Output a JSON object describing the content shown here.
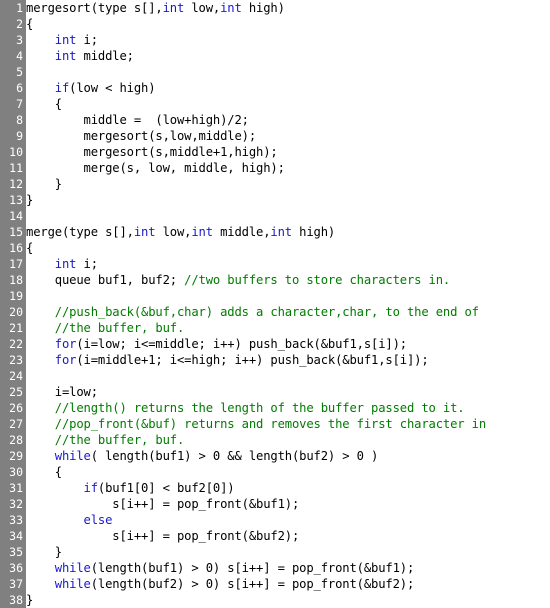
{
  "editor": {
    "language": "c",
    "gutter_bg": "#808080",
    "gutter_fg": "#ffffff",
    "background": "#ffffff",
    "text_color": "#000000",
    "keyword_color": "#1919CC",
    "comment_color": "#007C00",
    "total_lines": 38,
    "line_numbers": [
      "1",
      "2",
      "3",
      "4",
      "5",
      "6",
      "7",
      "8",
      "9",
      "10",
      "11",
      "12",
      "13",
      "14",
      "15",
      "16",
      "17",
      "18",
      "19",
      "20",
      "21",
      "22",
      "23",
      "24",
      "25",
      "26",
      "27",
      "28",
      "29",
      "30",
      "31",
      "32",
      "33",
      "34",
      "35",
      "36",
      "37",
      "38"
    ]
  },
  "code": {
    "lines": [
      {
        "n": "1",
        "tokens": [
          {
            "t": "plain",
            "v": "mergesort(type s[],"
          },
          {
            "t": "kw",
            "v": "int"
          },
          {
            "t": "plain",
            "v": " low,"
          },
          {
            "t": "kw",
            "v": "int"
          },
          {
            "t": "plain",
            "v": " high)"
          }
        ]
      },
      {
        "n": "2",
        "tokens": [
          {
            "t": "plain",
            "v": "{"
          }
        ]
      },
      {
        "n": "3",
        "tokens": [
          {
            "t": "plain",
            "v": "    "
          },
          {
            "t": "kw",
            "v": "int"
          },
          {
            "t": "plain",
            "v": " i;"
          }
        ]
      },
      {
        "n": "4",
        "tokens": [
          {
            "t": "plain",
            "v": "    "
          },
          {
            "t": "kw",
            "v": "int"
          },
          {
            "t": "plain",
            "v": " middle;"
          }
        ]
      },
      {
        "n": "5",
        "tokens": [
          {
            "t": "plain",
            "v": ""
          }
        ]
      },
      {
        "n": "6",
        "tokens": [
          {
            "t": "plain",
            "v": "    "
          },
          {
            "t": "kw",
            "v": "if"
          },
          {
            "t": "plain",
            "v": "(low < high)"
          }
        ]
      },
      {
        "n": "7",
        "tokens": [
          {
            "t": "plain",
            "v": "    {"
          }
        ]
      },
      {
        "n": "8",
        "tokens": [
          {
            "t": "plain",
            "v": "        middle =  (low+high)/2;"
          }
        ]
      },
      {
        "n": "9",
        "tokens": [
          {
            "t": "plain",
            "v": "        mergesort(s,low,middle);"
          }
        ]
      },
      {
        "n": "10",
        "tokens": [
          {
            "t": "plain",
            "v": "        mergesort(s,middle+1,high);"
          }
        ]
      },
      {
        "n": "11",
        "tokens": [
          {
            "t": "plain",
            "v": "        merge(s, low, middle, high);"
          }
        ]
      },
      {
        "n": "12",
        "tokens": [
          {
            "t": "plain",
            "v": "    }"
          }
        ]
      },
      {
        "n": "13",
        "tokens": [
          {
            "t": "plain",
            "v": "}"
          }
        ]
      },
      {
        "n": "14",
        "tokens": [
          {
            "t": "plain",
            "v": ""
          }
        ]
      },
      {
        "n": "15",
        "tokens": [
          {
            "t": "plain",
            "v": "merge(type s[],"
          },
          {
            "t": "kw",
            "v": "int"
          },
          {
            "t": "plain",
            "v": " low,"
          },
          {
            "t": "kw",
            "v": "int"
          },
          {
            "t": "plain",
            "v": " middle,"
          },
          {
            "t": "kw",
            "v": "int"
          },
          {
            "t": "plain",
            "v": " high)"
          }
        ]
      },
      {
        "n": "16",
        "tokens": [
          {
            "t": "plain",
            "v": "{"
          }
        ]
      },
      {
        "n": "17",
        "tokens": [
          {
            "t": "plain",
            "v": "    "
          },
          {
            "t": "kw",
            "v": "int"
          },
          {
            "t": "plain",
            "v": " i;"
          }
        ]
      },
      {
        "n": "18",
        "tokens": [
          {
            "t": "plain",
            "v": "    queue buf1, buf2; "
          },
          {
            "t": "cm",
            "v": "//two buffers to store characters in."
          }
        ]
      },
      {
        "n": "19",
        "tokens": [
          {
            "t": "plain",
            "v": ""
          }
        ]
      },
      {
        "n": "20",
        "tokens": [
          {
            "t": "plain",
            "v": "    "
          },
          {
            "t": "cm",
            "v": "//push_back(&buf,char) adds a character,char, to the end of"
          }
        ]
      },
      {
        "n": "21",
        "tokens": [
          {
            "t": "plain",
            "v": "    "
          },
          {
            "t": "cm",
            "v": "//the buffer, buf."
          }
        ]
      },
      {
        "n": "22",
        "tokens": [
          {
            "t": "plain",
            "v": "    "
          },
          {
            "t": "kw",
            "v": "for"
          },
          {
            "t": "plain",
            "v": "(i=low; i<=middle; i++) push_back(&buf1,s[i]);"
          }
        ]
      },
      {
        "n": "23",
        "tokens": [
          {
            "t": "plain",
            "v": "    "
          },
          {
            "t": "kw",
            "v": "for"
          },
          {
            "t": "plain",
            "v": "(i=middle+1; i<=high; i++) push_back(&buf1,s[i]);"
          }
        ]
      },
      {
        "n": "24",
        "tokens": [
          {
            "t": "plain",
            "v": ""
          }
        ]
      },
      {
        "n": "25",
        "tokens": [
          {
            "t": "plain",
            "v": "    i=low;"
          }
        ]
      },
      {
        "n": "26",
        "tokens": [
          {
            "t": "plain",
            "v": "    "
          },
          {
            "t": "cm",
            "v": "//length() returns the length of the buffer passed to it."
          }
        ]
      },
      {
        "n": "27",
        "tokens": [
          {
            "t": "plain",
            "v": "    "
          },
          {
            "t": "cm",
            "v": "//pop_front(&buf) returns and removes the first character in"
          }
        ]
      },
      {
        "n": "28",
        "tokens": [
          {
            "t": "plain",
            "v": "    "
          },
          {
            "t": "cm",
            "v": "//the buffer, buf."
          }
        ]
      },
      {
        "n": "29",
        "tokens": [
          {
            "t": "plain",
            "v": "    "
          },
          {
            "t": "kw",
            "v": "while"
          },
          {
            "t": "plain",
            "v": "( length(buf1) > 0 && length(buf2) > 0 )"
          }
        ]
      },
      {
        "n": "30",
        "tokens": [
          {
            "t": "plain",
            "v": "    {"
          }
        ]
      },
      {
        "n": "31",
        "tokens": [
          {
            "t": "plain",
            "v": "        "
          },
          {
            "t": "kw",
            "v": "if"
          },
          {
            "t": "plain",
            "v": "(buf1[0] < buf2[0])"
          }
        ]
      },
      {
        "n": "32",
        "tokens": [
          {
            "t": "plain",
            "v": "            s[i++] = pop_front(&buf1);"
          }
        ]
      },
      {
        "n": "33",
        "tokens": [
          {
            "t": "plain",
            "v": "        "
          },
          {
            "t": "kw",
            "v": "else"
          }
        ]
      },
      {
        "n": "34",
        "tokens": [
          {
            "t": "plain",
            "v": "            s[i++] = pop_front(&buf2);"
          }
        ]
      },
      {
        "n": "35",
        "tokens": [
          {
            "t": "plain",
            "v": "    }"
          }
        ]
      },
      {
        "n": "36",
        "tokens": [
          {
            "t": "plain",
            "v": "    "
          },
          {
            "t": "kw",
            "v": "while"
          },
          {
            "t": "plain",
            "v": "(length(buf1) > 0) s[i++] = pop_front(&buf1);"
          }
        ]
      },
      {
        "n": "37",
        "tokens": [
          {
            "t": "plain",
            "v": "    "
          },
          {
            "t": "kw",
            "v": "while"
          },
          {
            "t": "plain",
            "v": "(length(buf2) > 0) s[i++] = pop_front(&buf2);"
          }
        ]
      },
      {
        "n": "38",
        "tokens": [
          {
            "t": "plain",
            "v": "}"
          }
        ]
      }
    ]
  }
}
